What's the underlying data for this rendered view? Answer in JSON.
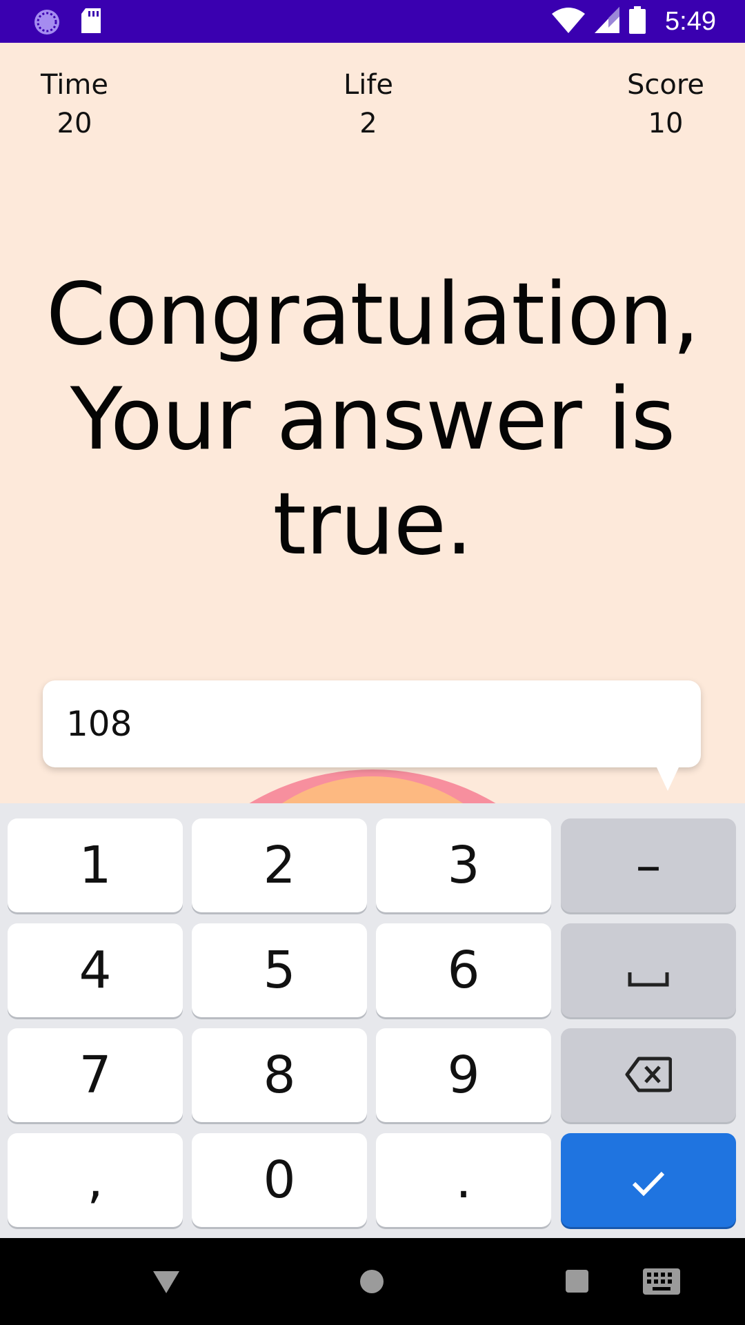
{
  "status_bar": {
    "time": "5:49",
    "left_icons": [
      "loading-circle-icon",
      "sd-card-icon"
    ],
    "right_icons": [
      "wifi-icon",
      "cell-signal-icon",
      "battery-icon"
    ],
    "background": "#3a00b0"
  },
  "game": {
    "time_label": "Time",
    "time_value": "20",
    "life_label": "Life",
    "life_value": "2",
    "score_label": "Score",
    "score_value": "10",
    "message_line1": "Congratulation,",
    "message_line2": "Your answer is",
    "message_line3": "true.",
    "background": "#fde9da"
  },
  "answer_input": {
    "value": "108"
  },
  "keyboard": {
    "keys": [
      {
        "label": "1"
      },
      {
        "label": "2"
      },
      {
        "label": "3"
      },
      {
        "label": "–"
      },
      {
        "label": "4"
      },
      {
        "label": "5"
      },
      {
        "label": "6"
      },
      {
        "label": "space-icon"
      },
      {
        "label": "7"
      },
      {
        "label": "8"
      },
      {
        "label": "9"
      },
      {
        "label": "backspace-icon"
      },
      {
        "label": ","
      },
      {
        "label": "0"
      },
      {
        "label": "."
      },
      {
        "label": "check-icon"
      }
    ],
    "accent": "#1f74e0"
  },
  "nav_bar": {
    "icons": [
      "back-icon",
      "home-icon",
      "recents-icon",
      "keyboard-icon"
    ]
  }
}
